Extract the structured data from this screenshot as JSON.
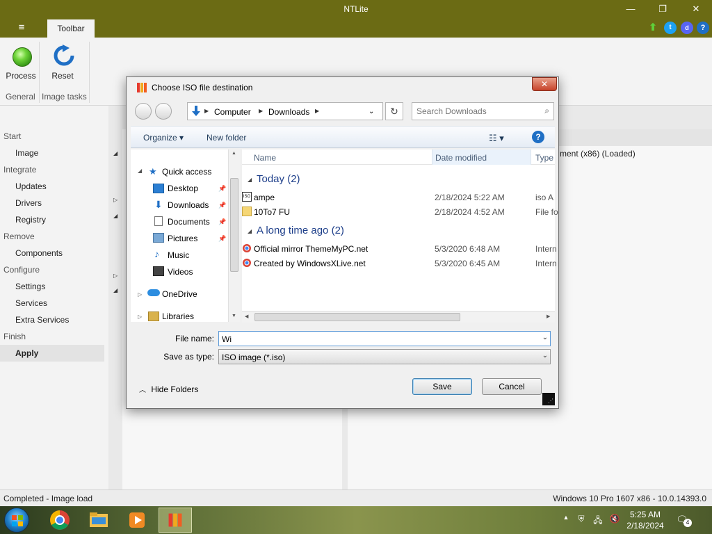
{
  "app": {
    "title": "NTLite",
    "ribbon_tab": "Toolbar",
    "ribbon": {
      "process_label": "Process",
      "reset_label": "Reset",
      "group_general": "General",
      "group_image_tasks": "Image tasks"
    },
    "nav": {
      "start": "Start",
      "image": "Image",
      "integrate": "Integrate",
      "updates": "Updates",
      "drivers": "Drivers",
      "registry": "Registry",
      "remove": "Remove",
      "components": "Components",
      "configure": "Configure",
      "settings": "Settings",
      "services": "Services",
      "extra_services": "Extra Services",
      "finish": "Finish",
      "apply": "Apply"
    },
    "content_loaded_text": "ment (x86)  (Loaded)",
    "status_left": "Completed - Image load",
    "status_right": "Windows 10 Pro 1607 x86 - 10.0.14393.0"
  },
  "dialog": {
    "title": "Choose ISO file destination",
    "close_glyph": "✕",
    "address": {
      "seg1": "Computer",
      "seg2": "Downloads"
    },
    "search_placeholder": "Search Downloads",
    "toolbar": {
      "organize": "Organize ▾",
      "new_folder": "New folder",
      "help": "?"
    },
    "navpane": {
      "quick_access": "Quick access",
      "desktop": "Desktop",
      "downloads": "Downloads",
      "documents": "Documents",
      "pictures": "Pictures",
      "music": "Music",
      "videos": "Videos",
      "onedrive": "OneDrive",
      "libraries": "Libraries"
    },
    "columns": {
      "name": "Name",
      "date_modified": "Date modified",
      "type": "Type"
    },
    "groups": [
      {
        "label": "Today (2)",
        "files": [
          {
            "name": "ampe",
            "date": "2/18/2024 5:22 AM",
            "type": "iso A"
          },
          {
            "name": "10To7 FU",
            "date": "2/18/2024 4:52 AM",
            "type": "File fo"
          }
        ]
      },
      {
        "label": "A long time ago (2)",
        "files": [
          {
            "name": "Official mirror ThemeMyPC.net",
            "date": "5/3/2020 6:48 AM",
            "type": "Intern"
          },
          {
            "name": "Created by WindowsXLive.net",
            "date": "5/3/2020 6:45 AM",
            "type": "Intern"
          }
        ]
      }
    ],
    "file_name_label": "File name:",
    "file_name_value": "Wi",
    "save_type_label": "Save as type:",
    "save_type_value": "ISO image (*.iso)",
    "hide_folders": "Hide Folders",
    "save_button": "Save",
    "cancel_button": "Cancel"
  },
  "taskbar": {
    "time": "5:25 AM",
    "date": "2/18/2024",
    "notification_count": "4"
  },
  "colors": {
    "title_bar": "#6b6b14",
    "accent_blue": "#1f6fc5",
    "group_header": "#1e3f8a"
  }
}
